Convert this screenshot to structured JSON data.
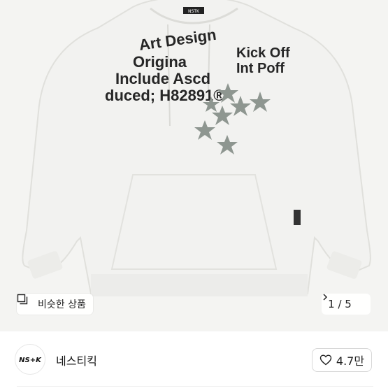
{
  "product": {
    "image_alt": "hoodie",
    "graphic_text": {
      "line1": "Art Design",
      "line2": "Origina",
      "line3": "Include Ascd",
      "line4": "duced; H82891®",
      "kick1": "Kick Off",
      "kick2": "Int Poff",
      "brand_tag": "NSTK"
    },
    "colors": {
      "hoodie": "#f3f3f1",
      "hoodie_shade": "#e3e3e0",
      "star": "#8e9690",
      "print": "#262626"
    }
  },
  "overlay": {
    "similar_label": "비슷한 상품",
    "similar_icon": "similar-products-icon",
    "pager_text": "1 / 5",
    "pager_icon": "chevron-right-icon"
  },
  "seller": {
    "logo_text": "NS+K",
    "name": "네스티킥",
    "like_count": "4.7만",
    "like_icon": "heart-outline-icon"
  }
}
